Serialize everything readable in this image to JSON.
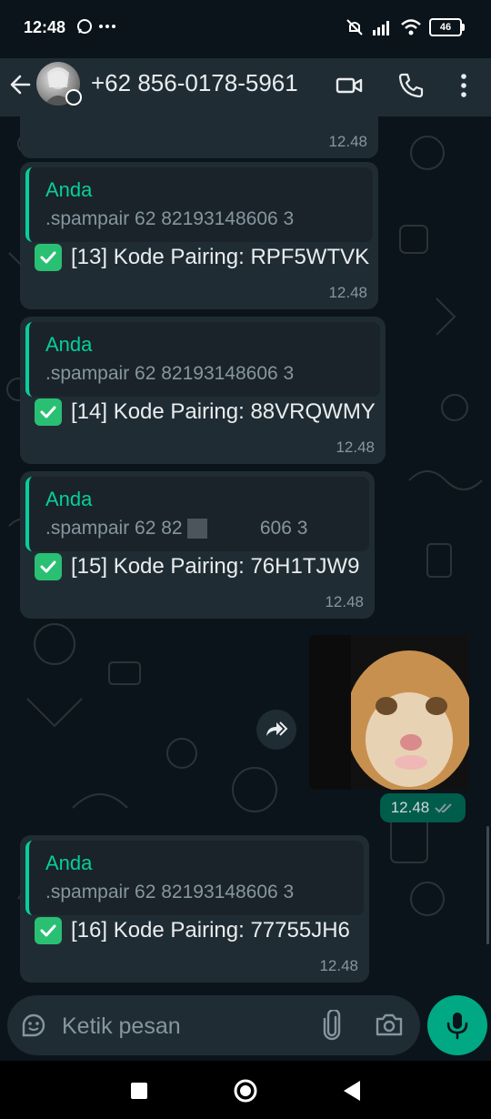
{
  "status_bar": {
    "time": "12:48",
    "battery": "46"
  },
  "header": {
    "contact": "+62 856-0178-5961"
  },
  "messages": [
    {
      "time": "12.48"
    },
    {
      "quote_name": "Anda",
      "quote_text": ".spampair 62 82193148606 3",
      "text": "[13] Kode Pairing: RPF5WTVK",
      "time": "12.48"
    },
    {
      "quote_name": "Anda",
      "quote_text": ".spampair 62 82193148606 3",
      "text": "[14] Kode Pairing: 88VRQWMY",
      "time": "12.48"
    },
    {
      "quote_name": "Anda",
      "quote_text_a": ".spampair 62 82",
      "quote_text_b": " 606 3",
      "text": "[15] Kode Pairing: 76H1TJW9",
      "time": "12.48"
    },
    {
      "quote_name": "Anda",
      "quote_text": ".spampair 62 82193148606 3",
      "text": "[16] Kode Pairing: 77755JH6",
      "time": "12.48"
    }
  ],
  "outgoing_image": {
    "time": "12.48"
  },
  "composer": {
    "placeholder": "Ketik pesan"
  },
  "icons": {
    "status": [
      "whatsapp-icon",
      "more-dots-icon",
      "mute-icon",
      "signal-icon",
      "wifi-icon",
      "battery-icon"
    ],
    "header": [
      "back-arrow-icon",
      "video-call-icon",
      "phone-icon",
      "menu-icon"
    ],
    "composer": [
      "sticker-icon",
      "attach-icon",
      "camera-icon",
      "mic-icon"
    ],
    "nav": [
      "recent-apps-icon",
      "home-icon",
      "back-icon"
    ]
  },
  "colors": {
    "background": "#0b141a",
    "incoming_bubble": "#202c33",
    "outgoing_bubble": "#005c4b",
    "accent": "#06cf9c",
    "mic_button": "#00a884"
  }
}
